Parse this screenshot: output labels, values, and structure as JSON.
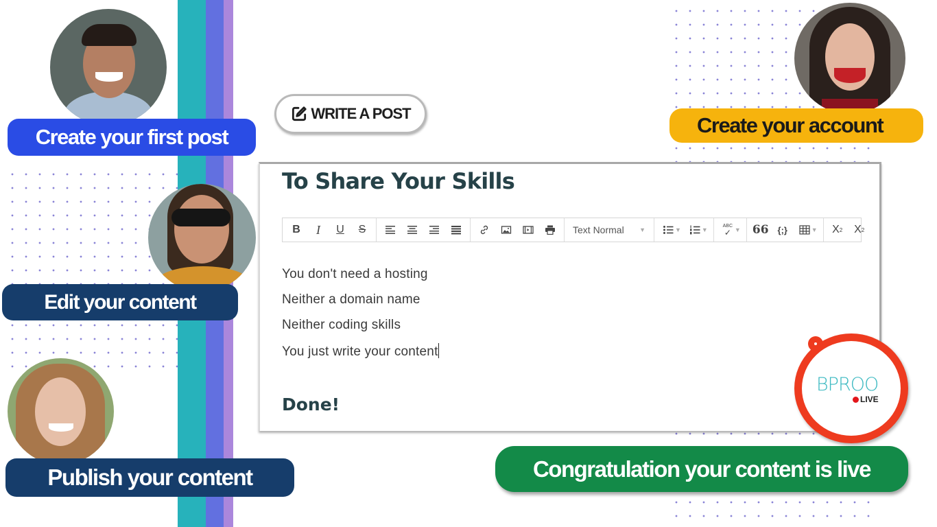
{
  "colors": {
    "stripe_teal": "#27b2bb",
    "stripe_blue": "#6270e0",
    "stripe_violet": "#ab87dc",
    "pill_first_post": "#2a4ce5",
    "pill_navy": "#163d6b",
    "pill_account": "#f6b30d",
    "pill_live": "#138a48",
    "logo_ring": "#ee3b1f",
    "logo_text": "#3bb9c1"
  },
  "steps": {
    "first_post": "Create your first post",
    "edit": "Edit your content",
    "publish": "Publish your content",
    "account": "Create your account",
    "live": "Congratulation your content is live"
  },
  "write_button": {
    "icon": "edit-square-icon",
    "label": "WRITE A POST"
  },
  "editor": {
    "title": "To Share Your Skills",
    "toolbar": {
      "groups": [
        [
          "bold-icon",
          "italic-icon",
          "underline-icon",
          "strikethrough-icon"
        ],
        [
          "align-left-icon",
          "align-center-icon",
          "align-right-icon",
          "align-justify-icon"
        ],
        [
          "link-icon",
          "image-icon",
          "video-icon",
          "print-icon"
        ],
        [
          "format-select"
        ],
        [
          "bulleted-list-icon",
          "numbered-list-icon"
        ],
        [
          "spellcheck-icon"
        ],
        [
          "blockquote-icon",
          "code-icon",
          "table-icon"
        ],
        [
          "subscript-icon",
          "superscript-icon"
        ]
      ],
      "format_value": "Text Normal",
      "labels": {
        "bold": "B",
        "italic": "I",
        "underline": "U",
        "strike": "S",
        "spell": "ABC",
        "quote": "66",
        "code": "{;}"
      }
    },
    "lines": [
      "You don't need a hosting",
      "Neither a domain name",
      "Neither coding skills",
      "You just write your content"
    ],
    "done": "Done!"
  },
  "logo": {
    "brand": "BPROO",
    "live": "LIVE"
  }
}
